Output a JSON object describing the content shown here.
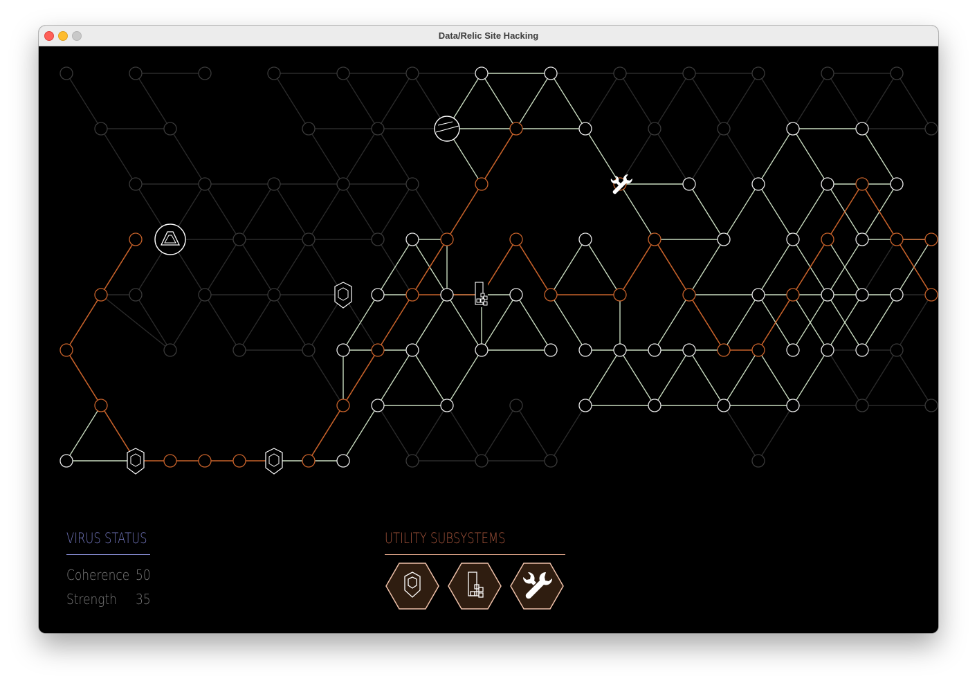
{
  "window": {
    "title": "Data/Relic Site Hacking"
  },
  "colors": {
    "background": "#000000",
    "inactive_edge": "#2b2b2b",
    "revealed_edge": "#c9dcc0",
    "path_edge": "#c8622a",
    "node_stroke": "#e8e8e8",
    "virus_accent": "#8a8fd8",
    "utility_accent": "#e3a88b",
    "utility_fill": "#2f1d10"
  },
  "virus_status": {
    "title": "VIRUS STATUS",
    "coherence_label": "Coherence",
    "coherence_value": "50",
    "strength_label": "Strength",
    "strength_value": "35"
  },
  "utility_subsystems": {
    "title": "UTILITY SUBSYSTEMS",
    "slots": [
      {
        "icon": "shield-icon"
      },
      {
        "icon": "virus-module-icon"
      },
      {
        "icon": "wrench-icon"
      }
    ]
  },
  "board": {
    "special_nodes": [
      {
        "type": "data-core",
        "icon": "data-core-icon"
      },
      {
        "type": "restoration-node",
        "icon": "wrench-icon"
      },
      {
        "type": "firewall",
        "icon": "firewall-icon"
      },
      {
        "type": "virus-suppressor",
        "icon": "triangle-icon"
      },
      {
        "type": "anti-virus",
        "icon": "shield-icon"
      },
      {
        "type": "anti-virus",
        "icon": "shield-icon"
      },
      {
        "type": "anti-virus",
        "icon": "shield-icon"
      }
    ]
  }
}
